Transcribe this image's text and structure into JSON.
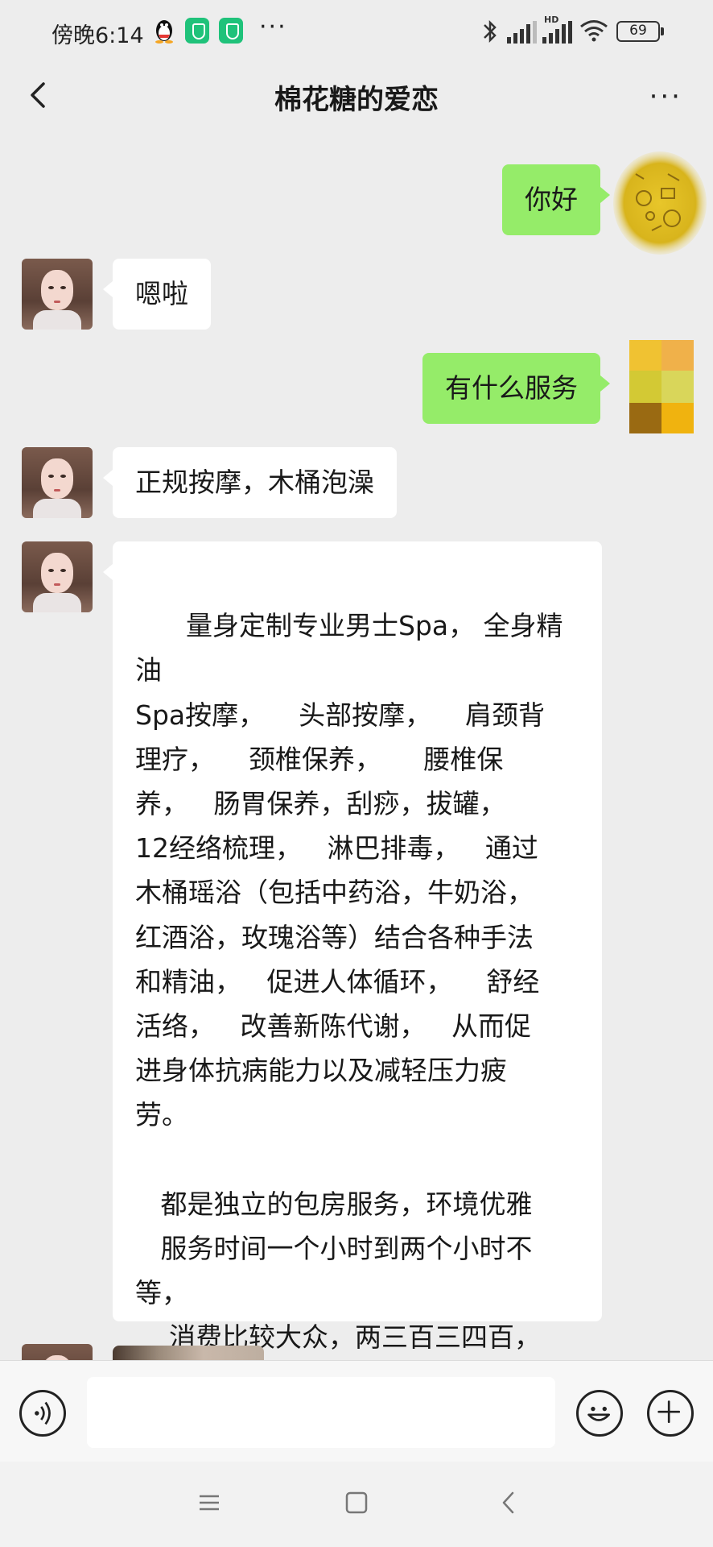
{
  "status_bar": {
    "time": "傍晚6:14",
    "more_glyph": "···",
    "battery": "69",
    "hd_label": "HD"
  },
  "header": {
    "title": "棉花糖的爱恋",
    "more_glyph": "···"
  },
  "messages": [
    {
      "side": "out",
      "text": "你好"
    },
    {
      "side": "in",
      "text": "嗯啦"
    },
    {
      "side": "out",
      "text": "有什么服务"
    },
    {
      "side": "in",
      "text": "正规按摩，木桶泡澡"
    },
    {
      "side": "in",
      "text": "量身定制专业男士Spa， 全身精油\nSpa按摩，    头部按摩，    肩颈背\n理疗，    颈椎保养，     腰椎保\n养，   肠胃保养，刮痧，拔罐，\n12经络梳理，   淋巴排毒，   通过\n木桶瑶浴（包括中药浴，牛奶浴，\n红酒浴，玫瑰浴等）结合各种手法\n和精油，   促进人体循环，    舒经\n活络，   改善新陈代谢，   从而促\n进身体抗病能力以及减轻压力疲\n劳。\n\n   都是独立的包房服务，环境优雅\n   服务时间一个小时到两个小时不\n等，\n    消费比较大众，两三百三四百，\n具体看你怎么选择！"
    }
  ],
  "icons": {
    "back": "chevron-left-icon",
    "more": "more-dots-icon",
    "voice": "voice-icon",
    "emoji": "emoji-icon",
    "plus": "plus-icon"
  },
  "input": {
    "value": ""
  }
}
